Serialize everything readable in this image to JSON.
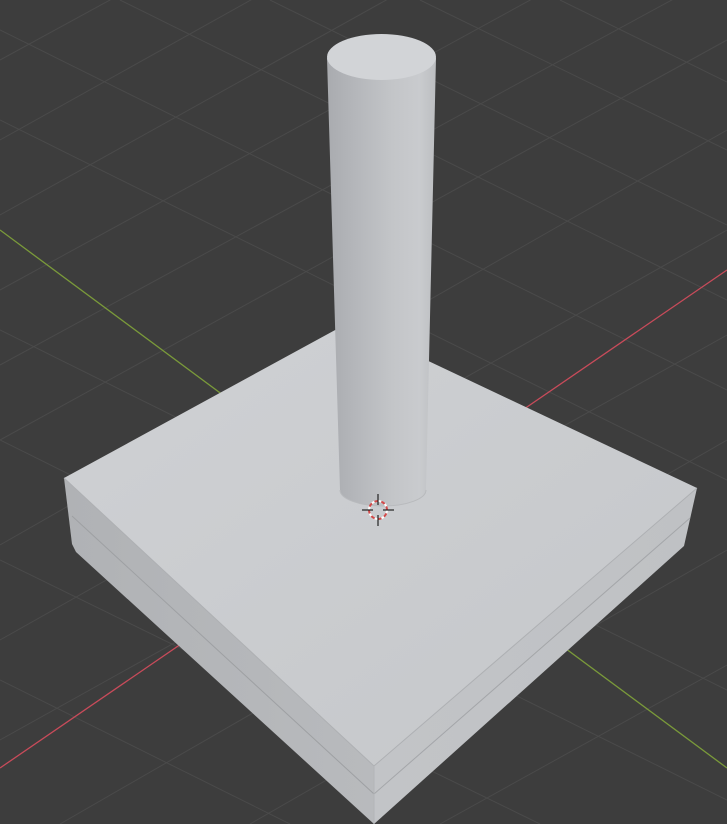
{
  "viewport": {
    "type": "3d-viewport",
    "shading": "solid",
    "background_color": "#3d3d3d",
    "grid_color": "#4a4a4a",
    "x_axis_color": "#c84b5a",
    "y_axis_color": "#7a9a3a"
  },
  "scene": {
    "objects": [
      {
        "name": "base-slab",
        "shape": "box",
        "color": "#c6c8cb"
      },
      {
        "name": "pillar",
        "shape": "cylinder",
        "color": "#b9bbbf"
      }
    ],
    "cursor": {
      "icon": "3d-cursor-icon",
      "colors": [
        "#d24a4a",
        "#ffffff",
        "#222222"
      ]
    }
  }
}
